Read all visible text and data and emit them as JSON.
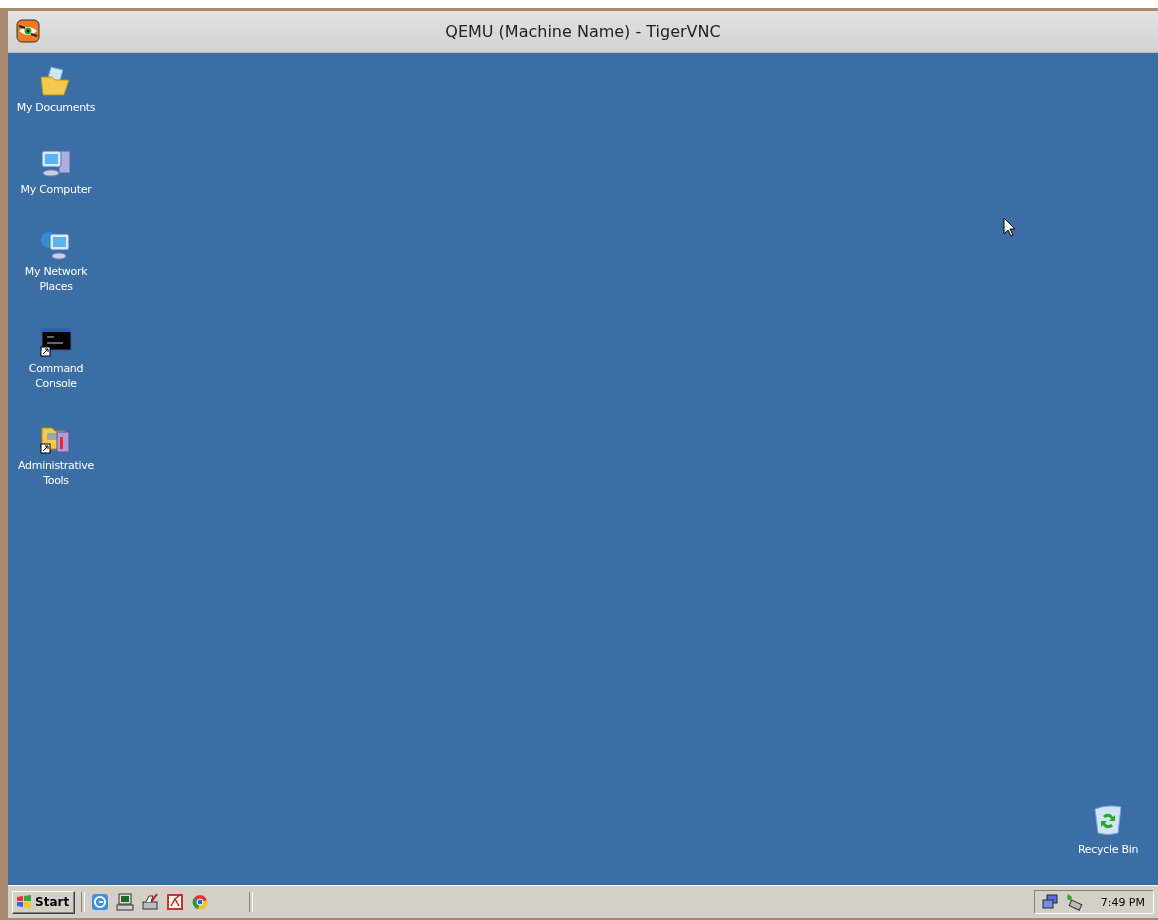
{
  "window": {
    "title": "QEMU (Machine Name) - TigerVNC"
  },
  "desktop_icons": [
    {
      "kind": "documents",
      "label": "My Documents"
    },
    {
      "kind": "computer",
      "label": "My Computer"
    },
    {
      "kind": "network",
      "label": "My Network Places"
    },
    {
      "kind": "console",
      "label": "Command Console"
    },
    {
      "kind": "tools",
      "label": "Administrative Tools"
    }
  ],
  "recycle_bin": {
    "kind": "recycle",
    "label": "Recycle Bin"
  },
  "taskbar": {
    "start_label": "Start",
    "quick_launch": [
      {
        "kind": "browser"
      },
      {
        "kind": "computer"
      },
      {
        "kind": "printer"
      },
      {
        "kind": "document"
      },
      {
        "kind": "chrome"
      }
    ],
    "tray": [
      {
        "kind": "network"
      },
      {
        "kind": "hardware"
      }
    ],
    "clock": "7:49 PM"
  }
}
